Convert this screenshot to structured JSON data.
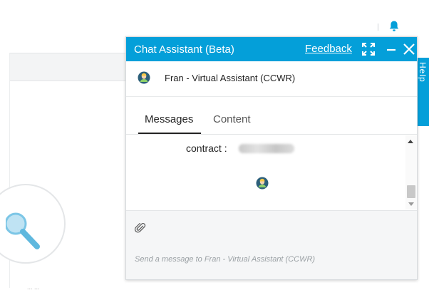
{
  "chat": {
    "title": "Chat Assistant (Beta)",
    "feedback_label": "Feedback",
    "agent_name": "Fran - Virtual Assistant (CCWR)",
    "tabs": [
      {
        "label": "Messages",
        "active": true
      },
      {
        "label": "Content",
        "active": false
      }
    ],
    "message_text": "contract :",
    "input_placeholder": "Send a message to Fran - Virtual Assistant (CCWR)",
    "icons": [
      "expand-icon",
      "minimize-icon",
      "close-icon",
      "attach-icon",
      "avatar-icon"
    ]
  },
  "background": {
    "help_tab_label": "Help",
    "bottom_text": "... ..."
  },
  "colors": {
    "accent": "#049fd9",
    "header_text": "#ffffff",
    "bell": "#049fd9"
  }
}
